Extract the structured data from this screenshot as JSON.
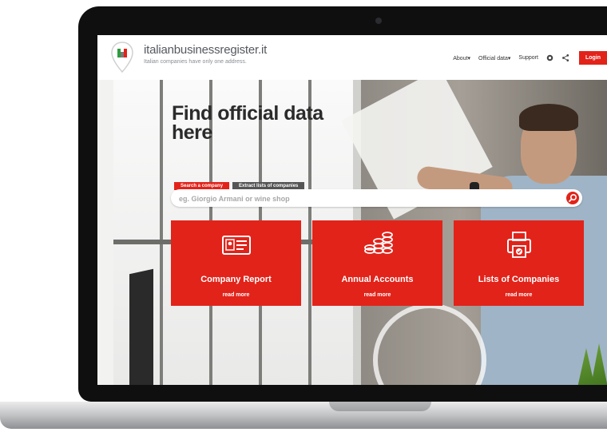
{
  "site": {
    "brand": "italianbusinessregister.it",
    "tagline": "Italian companies have only one address.",
    "logo_mark": "ii"
  },
  "nav": {
    "about": "About",
    "official_data": "Official data",
    "support": "Support",
    "login": "Login",
    "icons": [
      "globe-icon",
      "share-icon"
    ]
  },
  "hero": {
    "title": "Find official data here",
    "tabs": [
      "Search a company",
      "Extract lists of companies"
    ],
    "search_placeholder": "eg. Giorgio Armani or wine shop"
  },
  "cards": [
    {
      "title": "Company Report",
      "link": "read more",
      "icon": "id-card-icon"
    },
    {
      "title": "Annual Accounts",
      "link": "read more",
      "icon": "coins-icon"
    },
    {
      "title": "Lists of Companies",
      "link": "read more",
      "icon": "printer-icon"
    }
  ],
  "colors": {
    "accent": "#e2231a",
    "text_dark": "#2b2b2b"
  }
}
